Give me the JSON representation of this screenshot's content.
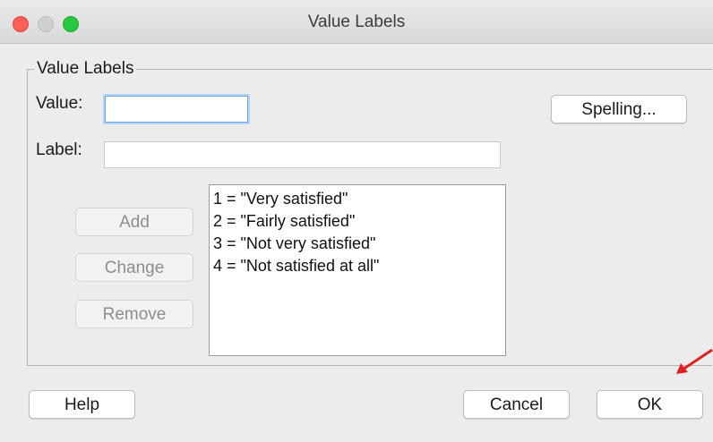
{
  "window": {
    "title": "Value Labels"
  },
  "group": {
    "legend": "Value Labels"
  },
  "value": {
    "label": "Value:",
    "input_value": ""
  },
  "label_field": {
    "label": "Label:",
    "input_value": ""
  },
  "buttons": {
    "spelling": "Spelling...",
    "add": "Add",
    "change": "Change",
    "remove": "Remove",
    "help": "Help",
    "cancel": "Cancel",
    "ok": "OK"
  },
  "labels_list": [
    "1 = \"Very satisfied\"",
    "2 = \"Fairly satisfied\"",
    "3 = \"Not very satisfied\"",
    "4 = \"Not satisfied at all\""
  ],
  "colors": {
    "annotation_arrow": "#e02020",
    "focus_ring": "#6aa4e0"
  }
}
